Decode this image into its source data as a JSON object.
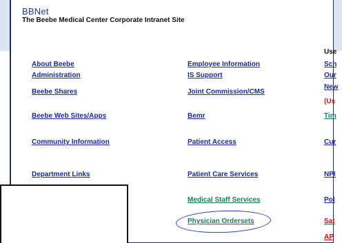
{
  "site": {
    "title": "BBNet",
    "subtitle": "The Beebe Medical Center Corporate Intranet Site"
  },
  "column1": [
    {
      "label": "About Beebe"
    },
    {
      "label": "Administration"
    },
    {
      "label": "Beebe Shares"
    },
    {
      "label": "Beebe Web Sites/Apps"
    },
    {
      "label": "Community Information"
    },
    {
      "label": "Department Links"
    }
  ],
  "column2": [
    {
      "label": "Employee Information"
    },
    {
      "label": "IS Support"
    },
    {
      "label": "Joint Commission/CMS"
    },
    {
      "label": "Bemr"
    },
    {
      "label": "Patient Access"
    },
    {
      "label": "Patient Care Services"
    },
    {
      "label": "Medical Staff Services"
    },
    {
      "label": "Physician Ordersets"
    }
  ],
  "column3": {
    "header": "Use",
    "items": [
      {
        "label": "Sch"
      },
      {
        "label": "Our"
      },
      {
        "label": "New"
      },
      {
        "label": "Tim"
      },
      {
        "label": "Cur"
      },
      {
        "label": "NPI"
      },
      {
        "label": "Pol"
      },
      {
        "label": "Sat"
      },
      {
        "label": "AP"
      }
    ],
    "note": "(Us"
  },
  "colors": {
    "link_blue": "#1a2a9a",
    "link_green": "#1f7a5a",
    "link_red": "#cc1111",
    "annotation_circle": "#2a3cc8",
    "top_band": "#dce6f0"
  }
}
